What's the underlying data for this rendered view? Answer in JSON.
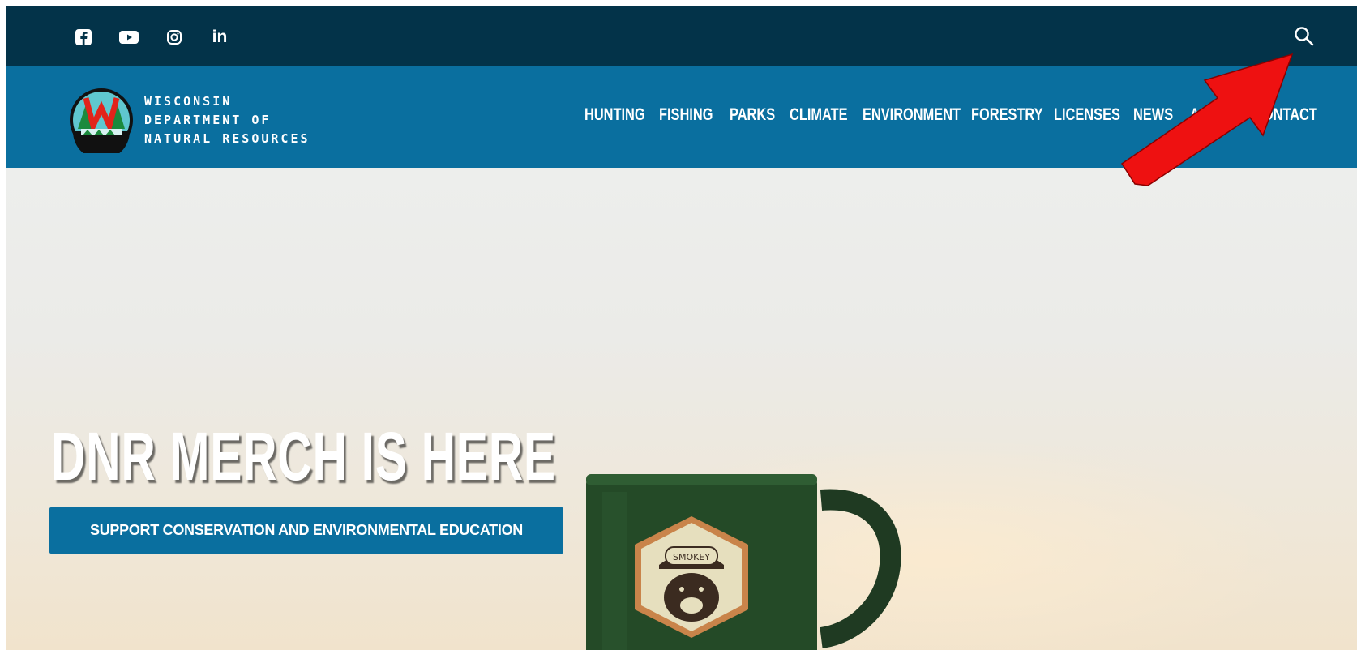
{
  "topbar": {
    "social": [
      {
        "name": "facebook"
      },
      {
        "name": "youtube"
      },
      {
        "name": "instagram"
      },
      {
        "name": "linkedin",
        "label": "in"
      }
    ]
  },
  "logo": {
    "line1": "WISCONSIN",
    "line2": "DEPARTMENT OF",
    "line3": "NATURAL RESOURCES"
  },
  "nav": {
    "items": [
      "HUNTING",
      "FISHING",
      "PARKS",
      "CLIMATE",
      "ENVIRONMENT",
      "FORESTRY",
      "LICENSES",
      "NEWS",
      "ABOUT",
      "CONTACT"
    ]
  },
  "hero": {
    "title": "DNR MERCH IS HERE",
    "cta": "SUPPORT CONSERVATION AND ENVIRONMENTAL EDUCATION",
    "badge_text": "SMOKEY"
  },
  "colors": {
    "topbar": "#033349",
    "navbar": "#0a6f9f",
    "annotation_arrow": "#ee1111"
  }
}
